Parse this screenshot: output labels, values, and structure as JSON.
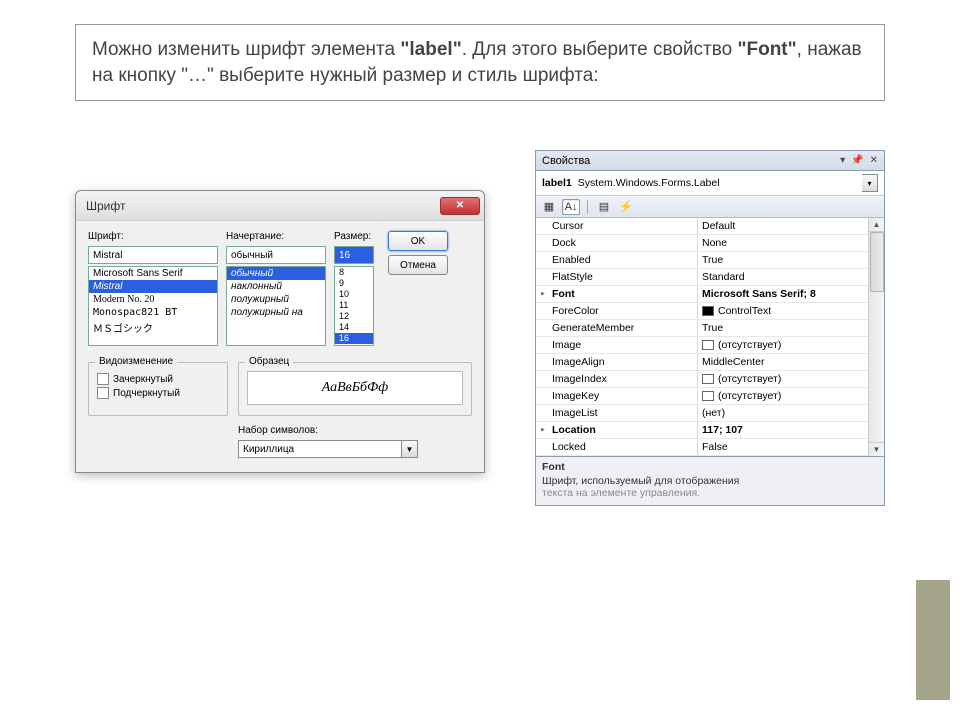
{
  "header": {
    "pre": "Можно изменить шрифт элемента ",
    "b1": "\"label\"",
    "mid": ". Для этого выберите свойство ",
    "b2": "\"Font\"",
    "post": ", нажав на кнопку \"…\" выберите нужный размер и стиль шрифта:"
  },
  "dialog": {
    "title": "Шрифт",
    "lbl_font": "Шрифт:",
    "lbl_style": "Начертание:",
    "lbl_size": "Размер:",
    "font_value": "Mistral",
    "style_value": "обычный",
    "size_value": "16",
    "fonts": [
      "Microsoft Sans Serif",
      "Mistral",
      "Modern No. 20",
      "Monospac821 BT",
      "ＭＳゴシック"
    ],
    "styles": [
      "обычный",
      "наклонный",
      "полужирный",
      "полужирный на"
    ],
    "sizes": [
      "8",
      "9",
      "10",
      "11",
      "12",
      "14",
      "16"
    ],
    "ok": "OK",
    "cancel": "Отмена",
    "grp_effects": "Видоизменение",
    "chk_strike": "Зачеркнутый",
    "chk_underline": "Подчеркнутый",
    "grp_sample": "Образец",
    "sample_text": "АаВвБбФф",
    "lbl_script": "Набор символов:",
    "script_value": "Кириллица"
  },
  "props": {
    "title": "Свойства",
    "object_name": "label1",
    "object_type": "System.Windows.Forms.Label",
    "rows": [
      {
        "exp": "",
        "name": "Cursor",
        "val": "Default"
      },
      {
        "exp": "",
        "name": "Dock",
        "val": "None"
      },
      {
        "exp": "",
        "name": "Enabled",
        "val": "True"
      },
      {
        "exp": "",
        "name": "FlatStyle",
        "val": "Standard"
      },
      {
        "exp": "▸",
        "name": "Font",
        "val": "Microsoft Sans Serif; 8"
      },
      {
        "exp": "",
        "name": "ForeColor",
        "val": "ControlText",
        "swatch": "black"
      },
      {
        "exp": "",
        "name": "GenerateMember",
        "val": "True"
      },
      {
        "exp": "",
        "name": "Image",
        "val": "(отсутствует)",
        "swatch": "empty"
      },
      {
        "exp": "",
        "name": "ImageAlign",
        "val": "MiddleCenter"
      },
      {
        "exp": "",
        "name": "ImageIndex",
        "val": "(отсутствует)",
        "swatch": "empty"
      },
      {
        "exp": "",
        "name": "ImageKey",
        "val": "(отсутствует)",
        "swatch": "empty"
      },
      {
        "exp": "",
        "name": "ImageList",
        "val": "(нет)"
      },
      {
        "exp": "▸",
        "name": "Location",
        "val": "117; 107"
      },
      {
        "exp": "",
        "name": "Locked",
        "val": "False"
      }
    ],
    "desc_title": "Font",
    "desc_text": "Шрифт, используемый для отображения",
    "desc_text2": "текста на элементе управления."
  }
}
